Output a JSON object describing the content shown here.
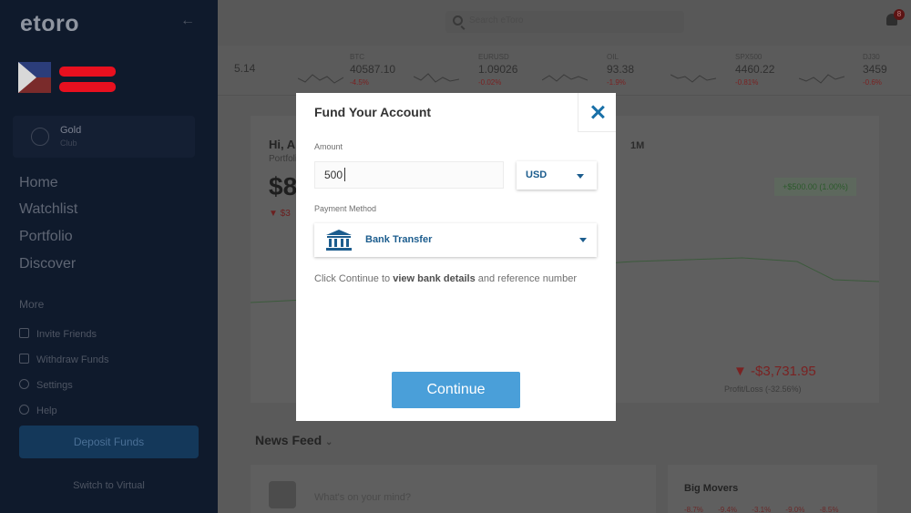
{
  "app": {
    "logo": "etoro"
  },
  "sidebar": {
    "account_card": {
      "title": "Gold",
      "subtitle": "Club"
    },
    "nav": [
      "Home",
      "Watchlist",
      "Portfolio",
      "Discover"
    ],
    "more_label": "More",
    "more_items": [
      "Invite Friends",
      "Withdraw Funds",
      "Settings",
      "Help"
    ],
    "deposit_button": "Deposit Funds",
    "switch_virtual": "Switch to Virtual"
  },
  "topbar": {
    "search_placeholder": "Search eToro",
    "notification_count": "8"
  },
  "tickers": [
    {
      "name": "",
      "price": "5.14",
      "change": ""
    },
    {
      "name": "BTC",
      "price": "40587.10",
      "change": "-4.5%"
    },
    {
      "name": "EURUSD",
      "price": "1.09026",
      "change": "-0.02%"
    },
    {
      "name": "OIL",
      "price": "93.38",
      "change": "-1.9%"
    },
    {
      "name": "SPX500",
      "price": "4460.22",
      "change": "-0.81%"
    },
    {
      "name": "DJ30",
      "price": "3459",
      "change": "-0.6%"
    }
  ],
  "portfolio": {
    "greeting": "Hi, A",
    "greeting_sub": "Portfolio",
    "balance": "$8",
    "change": "▼ $3",
    "range": "1M",
    "gain_badge": "+$500.00 (1.00%)",
    "profit_value": "▼ -$3,731.95",
    "profit_label": "Profit/Loss (-32.56%)"
  },
  "news": {
    "title": "News Feed",
    "prompt": "What's on your mind?",
    "big_movers_title": "Big Movers",
    "big_movers_values": [
      "-8.7%",
      "-9.4%",
      "-3.1%",
      "-9.0%",
      "-8.5%"
    ]
  },
  "modal": {
    "title": "Fund Your Account",
    "amount_label": "Amount",
    "amount_value": "500",
    "currency": "USD",
    "payment_method_label": "Payment Method",
    "payment_method": "Bank Transfer",
    "info_prefix": "Click Continue to ",
    "info_bold": "view bank details",
    "info_suffix": " and reference number",
    "continue_button": "Continue"
  },
  "colors": {
    "accent": "#1c5d8e",
    "button": "#4a9fd9",
    "close_icon": "#1970a8",
    "overlay": "#5a5a5a",
    "sidebar": "#0f1a2c"
  }
}
